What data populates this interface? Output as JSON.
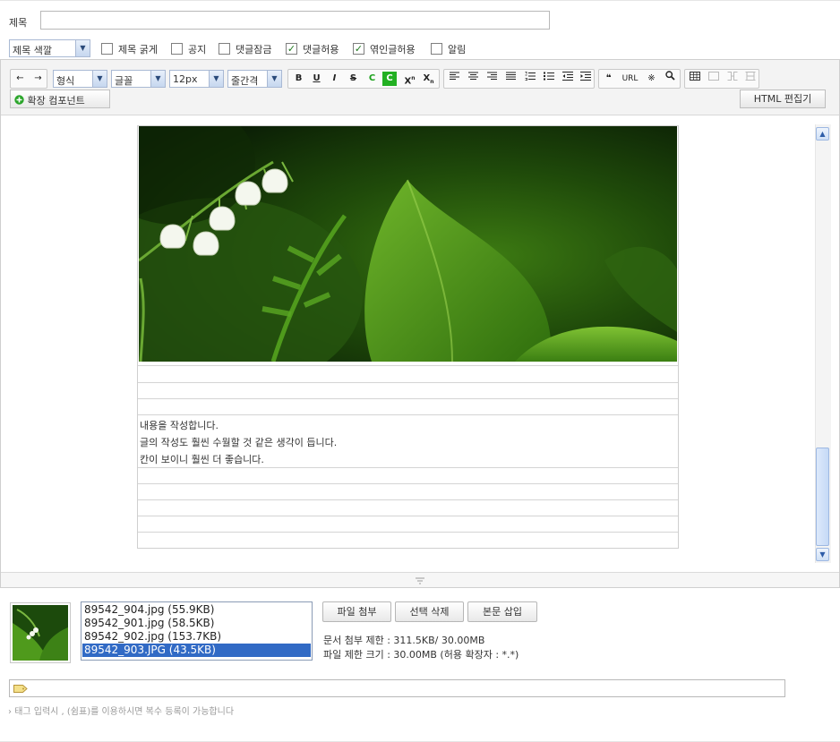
{
  "title": {
    "label": "제목",
    "value": ""
  },
  "options": {
    "title_color_select": "제목 색깔",
    "checkboxes": [
      {
        "label": "제목 굵게",
        "checked": false
      },
      {
        "label": "공지",
        "checked": false
      },
      {
        "label": "댓글잠금",
        "checked": false
      },
      {
        "label": "댓글허용",
        "checked": true
      },
      {
        "label": "엮인글허용",
        "checked": true
      },
      {
        "label": "알림",
        "checked": false
      }
    ]
  },
  "toolbar": {
    "undo": "←",
    "redo": "→",
    "format_select": "형식",
    "font_select": "글꼴",
    "size_select": "12px",
    "line_height_select": "줄간격",
    "bold": "B",
    "underline": "U",
    "italic": "I",
    "strike": "S",
    "font_color": "C",
    "bg_color": "C",
    "superscript": "X",
    "subscript": "X",
    "quote": "❝",
    "url": "URL",
    "special_char": "※",
    "search": "🔍",
    "extension_component": "확장 컴포넌트",
    "html_editor": "HTML 편집기"
  },
  "content": {
    "lines": [
      "내용을 작성합니다.",
      "글의 작성도 훨씬 수월할 것 같은 생각이 듭니다.",
      "칸이 보이니 훨씬 더 좋습니다."
    ]
  },
  "attachments": {
    "files": [
      {
        "name": "89542_904.jpg (55.9KB)",
        "selected": false
      },
      {
        "name": "89542_901.jpg (58.5KB)",
        "selected": false
      },
      {
        "name": "89542_902.jpg (153.7KB)",
        "selected": false
      },
      {
        "name": "89542_903.JPG (43.5KB)",
        "selected": true
      }
    ],
    "attach_button": "파일 첨부",
    "delete_button": "선택 삭제",
    "insert_button": "본문 삽입",
    "doc_limit": "문서 첨부 제한 : 311.5KB/ 30.00MB",
    "file_limit": "파일 제한 크기 : 30.00MB (허용 확장자 : *.*)"
  },
  "tags": {
    "value": "",
    "hint": "태그 입력시 , (쉼표)를 이용하시면 복수 등록이 가능합니다"
  },
  "colors": {
    "selection": "#316ac5",
    "check": "#1f7a1f",
    "leaf_green": "#3f8a1a"
  }
}
